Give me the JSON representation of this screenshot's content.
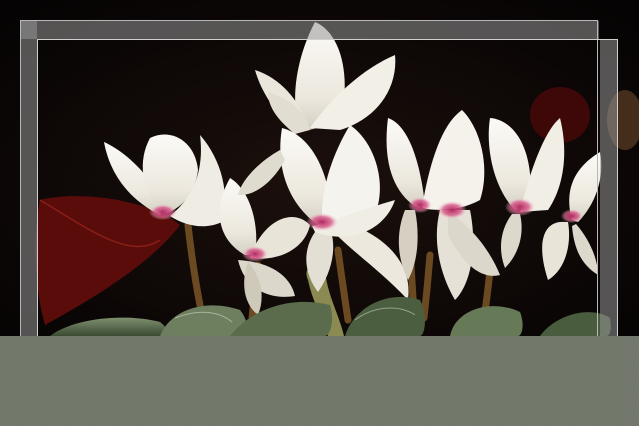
{
  "scene": {
    "subject": "white-pink-cyclamen-flowers",
    "colors": {
      "background": "#0b0706",
      "petal": "#f4f2ec",
      "petal_shadow": "#d9d4c8",
      "petal_base": "#c8386e",
      "leaf": "#5f7250",
      "leaf_dark": "#2c3a26",
      "red_leaf": "#6e0f0c",
      "stem": "#6b4a22",
      "frame_line": "#b8b8b8",
      "frame_band": "#969696",
      "bottom_band": "#6f7467"
    }
  }
}
